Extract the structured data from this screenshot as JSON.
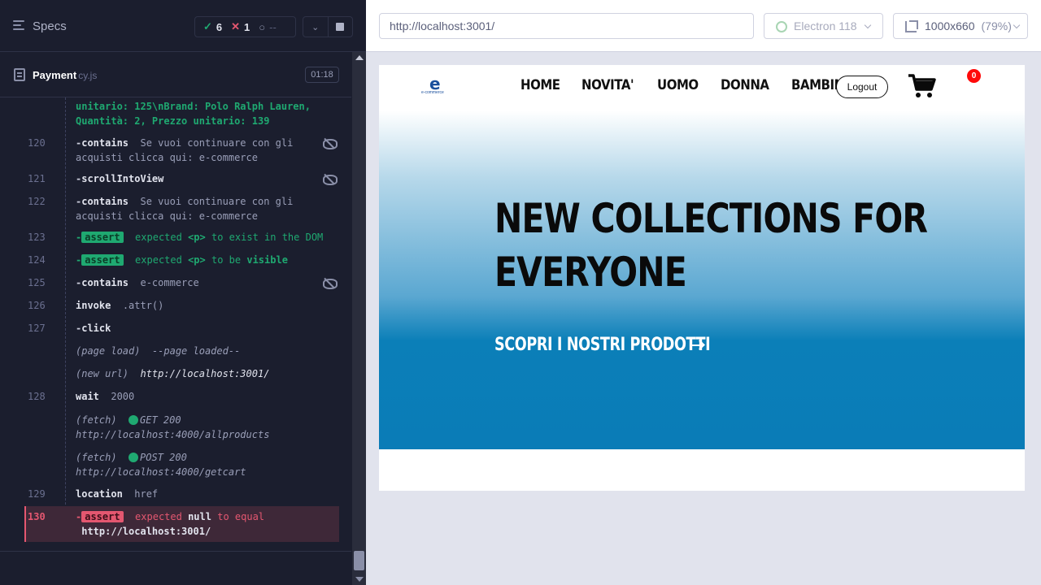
{
  "reporter": {
    "specs_label": "Specs",
    "stats": {
      "passed": "6",
      "failed": "1",
      "pending": "--"
    },
    "spec": {
      "name": "Payment",
      "ext": "cy.js",
      "duration": "01:18"
    },
    "log": [
      {
        "num": "",
        "parts": [
          "unitario: 125\\nBrand: Polo Ralph Lauren, Quantità: 2, Prezzo unitario: 139"
        ]
      },
      {
        "num": "120",
        "cmd": "contains",
        "arg": "Se vuoi continuare con gli acquisti clicca qui: e-commerce"
      },
      {
        "num": "121",
        "cmd": "scrollIntoView"
      },
      {
        "num": "122",
        "cmd": "contains",
        "arg": "Se vuoi continuare con gli acquisti clicca qui: e-commerce"
      },
      {
        "num": "123",
        "badge": "assert",
        "a": "expected",
        "b": "<p>",
        "c": "to exist in the DOM"
      },
      {
        "num": "124",
        "badge": "assert",
        "a": "expected",
        "b": "<p>",
        "c": "to be",
        "d": "visible"
      },
      {
        "num": "125",
        "cmd": "contains",
        "arg": "e-commerce"
      },
      {
        "num": "126",
        "cmd": "invoke",
        "arg": ".attr()"
      },
      {
        "num": "127",
        "cmd": "click"
      },
      {
        "num": "",
        "event": "(page load)",
        "arg": "--page loaded--"
      },
      {
        "num": "",
        "event": "(new url)",
        "arg": "http://localhost:3001/"
      },
      {
        "num": "128",
        "cmd": "wait",
        "arg": "2000"
      },
      {
        "num": "",
        "event": "(fetch)",
        "status": "GET 200",
        "arg": "http://localhost:4000/allproducts"
      },
      {
        "num": "",
        "event": "(fetch)",
        "status": "POST 200",
        "arg": "http://localhost:4000/getcart"
      },
      {
        "num": "129",
        "cmd": "location",
        "arg": "href"
      },
      {
        "num": "130",
        "badge": "assert",
        "a": "expected",
        "b": "null",
        "c": "to equal",
        "d": "http://localhost:3001/"
      }
    ]
  },
  "aut": {
    "url": "http://localhost:3001/",
    "browser": "Electron 118",
    "viewport": "1000x660",
    "scale": "(79%)",
    "site": {
      "logo_letter": "e",
      "logo_text": "e-commerce",
      "nav": [
        "HOME",
        "NOVITA'",
        "UOMO",
        "DONNA",
        "BAMBINO"
      ],
      "logout": "Logout",
      "cart_count": "0",
      "hero_title_1": "NEW COLLECTIONS FOR",
      "hero_title_2": "EVERYONE",
      "hero_cta": "SCOPRI I NOSTRI PRODOTTI"
    }
  },
  "colors": {
    "pass": "#1fa971",
    "fail": "#e45770",
    "hero_blue": "#0a7cb7"
  }
}
